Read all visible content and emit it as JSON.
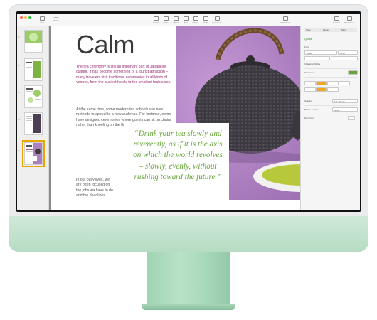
{
  "toolbar": {
    "zoom_value": "125%",
    "items": [
      {
        "label": "View"
      },
      {
        "label": "Zoom"
      },
      {
        "label": "Insert"
      },
      {
        "label": "Table"
      },
      {
        "label": "Chart"
      },
      {
        "label": "Text"
      },
      {
        "label": "Shape"
      },
      {
        "label": "Media"
      },
      {
        "label": "Comment"
      },
      {
        "label": "Collaborate"
      },
      {
        "label": "Format"
      },
      {
        "label": "Document"
      }
    ]
  },
  "thumbnails": [
    {
      "number": "1"
    },
    {
      "number": "2"
    },
    {
      "number": "3"
    },
    {
      "number": "4"
    },
    {
      "number": "5"
    }
  ],
  "document": {
    "title": "Calm",
    "lead": "The tea ceremony is still an important part of Japanese culture. It has become something of a tourist attraction – many travelers visit traditional ceremonies in all kinds of venues, from the busiest hotels to the smallest teahouses.",
    "body1": "At the same time, some modern tea schools use new methods to appeal to a new audience. For instance, some have designed ceremonies where guests can sit on chairs rather than kneeling on the floor.",
    "body2": "In our busy lives, we are often focused on the jobs we have to do and the deadlines",
    "pullquote": "“Drink your tea slowly and reverently, as if it is the axis on which the world revolves – slowly, evenly, without rushing toward the future.”"
  },
  "inspector": {
    "tabs": [
      "Style",
      "Layout",
      "More"
    ],
    "style_name": "Quote",
    "sections": [
      "Font",
      "Character Styles",
      "Text Color",
      "Spacing",
      "Bullets & Lists",
      "Drop Cap"
    ],
    "font_name": "Didot",
    "font_size": "18 pt",
    "spacing_value": "1.0 - Single",
    "bullets_value": "None"
  },
  "colors": {
    "lead_text": "#9a2f74",
    "quote_text": "#67a53a",
    "accent": "#f5a623",
    "chin": "#b6dcc3"
  }
}
